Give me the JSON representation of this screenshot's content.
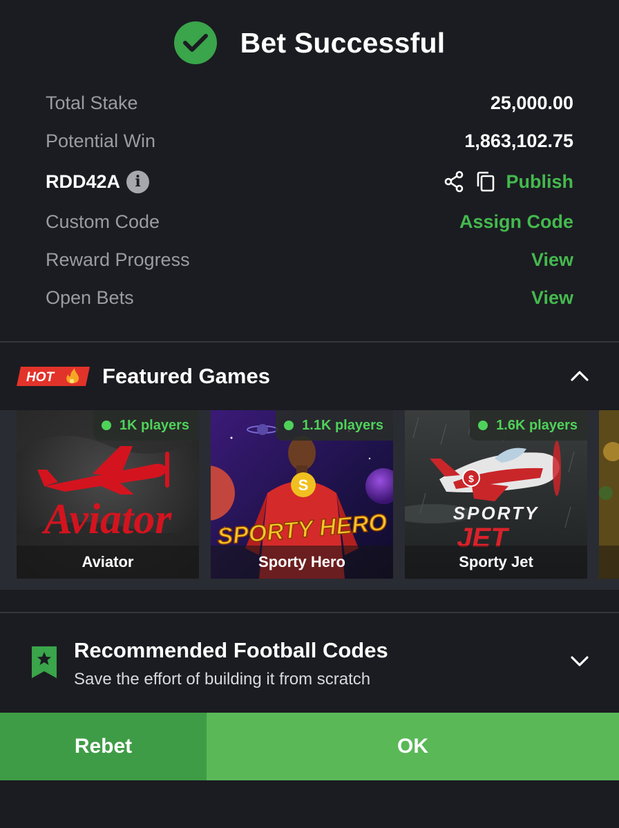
{
  "header": {
    "title": "Bet Successful"
  },
  "summary": {
    "total_stake_label": "Total Stake",
    "total_stake_value": "25,000.00",
    "potential_win_label": "Potential Win",
    "potential_win_value": "1,863,102.75",
    "booking_code": "RDD42A",
    "publish_label": "Publish",
    "custom_code_label": "Custom Code",
    "assign_code_label": "Assign Code",
    "reward_progress_label": "Reward Progress",
    "reward_progress_action": "View",
    "open_bets_label": "Open Bets",
    "open_bets_action": "View"
  },
  "featured": {
    "badge": "HOT",
    "title": "Featured Games",
    "games": [
      {
        "name": "Aviator",
        "players": "1K players",
        "logo_text": "Aviator"
      },
      {
        "name": "Sporty Hero",
        "players": "1.1K players",
        "logo_text": "SPORTY HERO"
      },
      {
        "name": "Sporty Jet",
        "players": "1.6K players",
        "logo_text_1": "SPORTY",
        "logo_text_2": "JET"
      }
    ]
  },
  "recommended": {
    "title": "Recommended Football Codes",
    "subtitle": "Save the effort of building it from scratch"
  },
  "actions": {
    "rebet_label": "Rebet",
    "ok_label": "OK"
  },
  "colors": {
    "accent_green": "#44b94e",
    "background": "#1b1c21",
    "hot_red": "#e2332a"
  }
}
